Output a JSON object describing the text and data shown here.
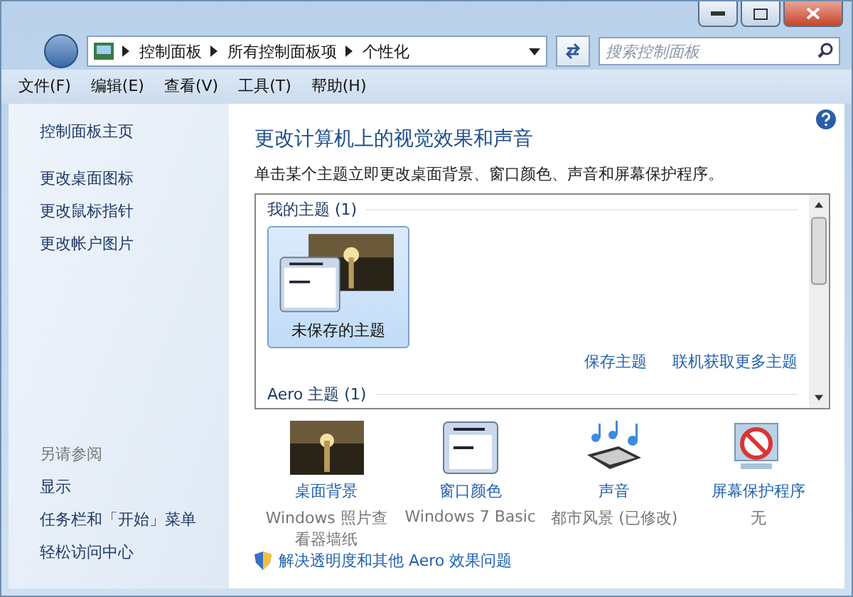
{
  "address_bar": {
    "breadcrumbs": [
      "控制面板",
      "所有控制面板项",
      "个性化"
    ]
  },
  "search": {
    "placeholder": "搜索控制面板"
  },
  "menu": [
    "文件(F)",
    "编辑(E)",
    "查看(V)",
    "工具(T)",
    "帮助(H)"
  ],
  "sidebar": {
    "home": "控制面板主页",
    "links": [
      "更改桌面图标",
      "更改鼠标指针",
      "更改帐户图片"
    ],
    "see_also_title": "另请参阅",
    "see_also": [
      "显示",
      "任务栏和「开始」菜单",
      "轻松访问中心"
    ]
  },
  "content": {
    "title": "更改计算机上的视觉效果和声音",
    "description": "单击某个主题立即更改桌面背景、窗口颜色、声音和屏幕保护程序。",
    "theme_groups": [
      {
        "title": "我的主题 (1)",
        "themes": [
          {
            "name": "未保存的主题",
            "selected": true
          }
        ]
      },
      {
        "title": "Aero 主题 (1)"
      }
    ],
    "theme_actions": [
      "保存主题",
      "联机获取更多主题"
    ],
    "settings": [
      {
        "kind": "wallpaper",
        "label": "桌面背景",
        "value": "Windows 照片查看器墙纸"
      },
      {
        "kind": "color",
        "label": "窗口颜色",
        "value": "Windows 7 Basic"
      },
      {
        "kind": "sound",
        "label": "声音",
        "value": "都市风景 (已修改)"
      },
      {
        "kind": "screensaver",
        "label": "屏幕保护程序",
        "value": "无"
      }
    ],
    "troubleshoot_link": "解决透明度和其他 Aero 效果问题"
  }
}
